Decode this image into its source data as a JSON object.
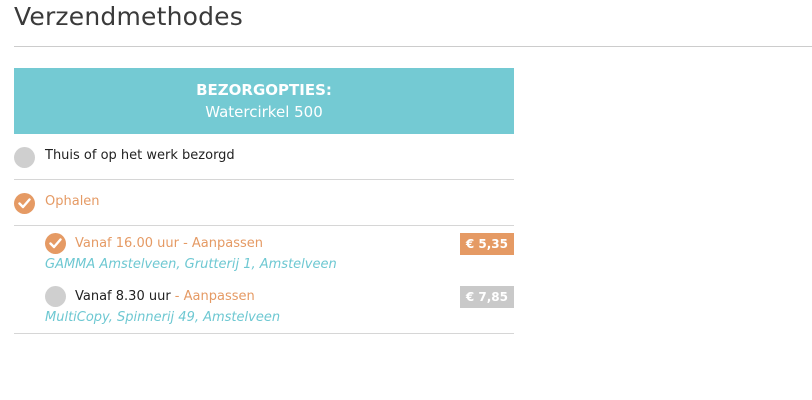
{
  "page": {
    "title": "Verzendmethodes"
  },
  "delivery": {
    "header_label": "BEZORGOPTIES:",
    "product": "Watercirkel 500",
    "options": [
      {
        "label": "Thuis of op het werk bezorgd",
        "selected": false
      },
      {
        "label": "Ophalen",
        "selected": true
      }
    ],
    "pickup_slots": [
      {
        "time": "Vanaf 16.00 uur",
        "separator": " - ",
        "edit_label": "Aanpassen",
        "address": "GAMMA Amstelveen, Grutterij 1, Amstelveen",
        "price": "€ 5,35",
        "selected": true
      },
      {
        "time": "Vanaf 8.30 uur",
        "separator": " - ",
        "edit_label": "Aanpassen",
        "address": "MultiCopy, Spinnerij 49, Amstelveen",
        "price": "€ 7,85",
        "selected": false
      }
    ]
  },
  "colors": {
    "header_bg": "#74cad3",
    "accent_orange": "#e59a64",
    "address_teal": "#6ec8d2",
    "radio_gray": "#cfcfcf",
    "price_gray": "#c9c9c9"
  }
}
